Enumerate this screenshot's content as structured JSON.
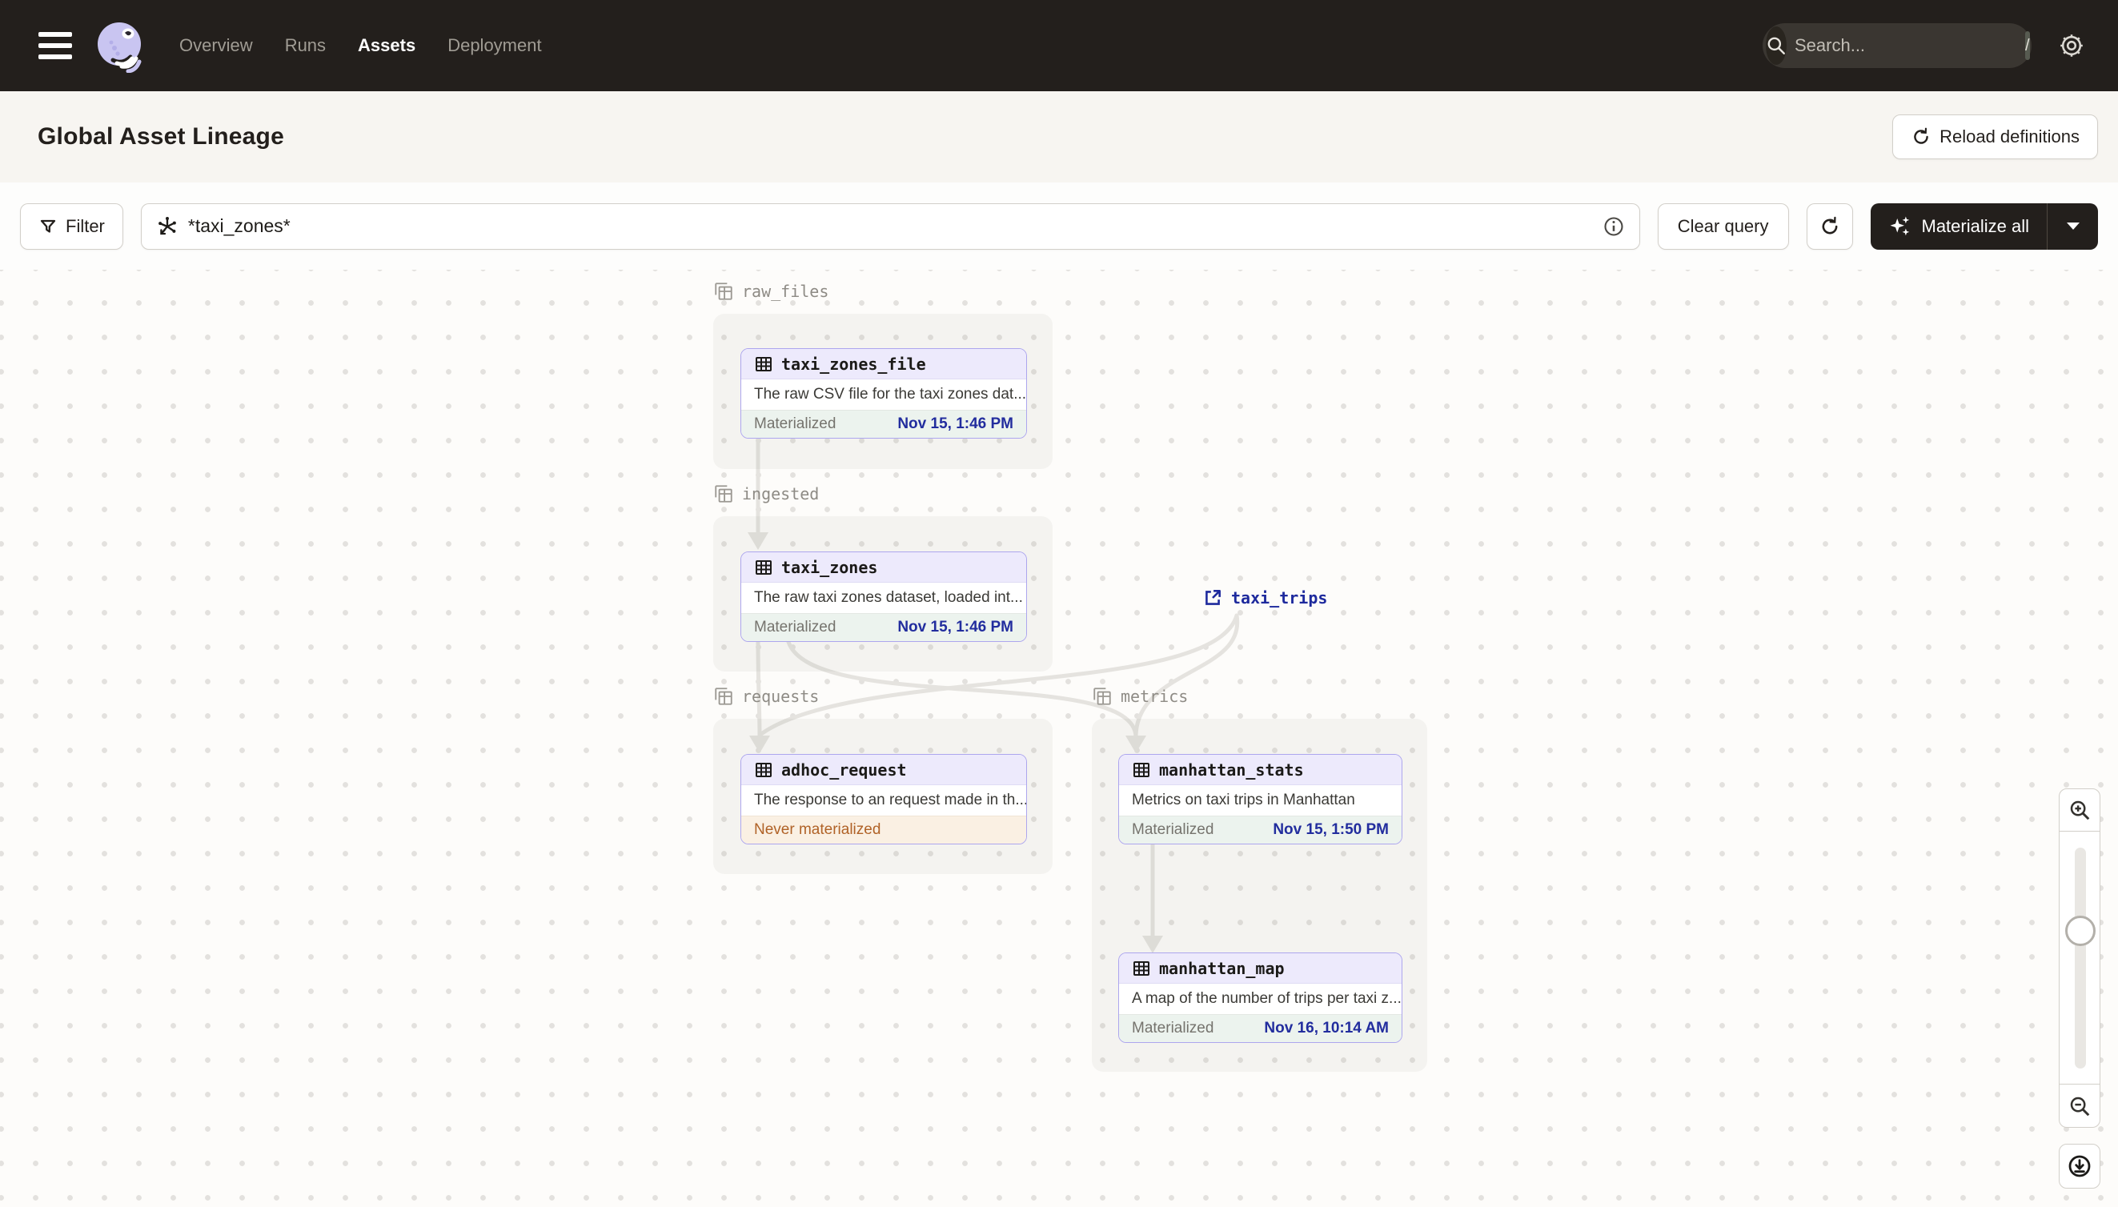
{
  "topnav": {
    "nav_items": [
      {
        "label": "Overview",
        "active": false
      },
      {
        "label": "Runs",
        "active": false
      },
      {
        "label": "Assets",
        "active": true
      },
      {
        "label": "Deployment",
        "active": false
      }
    ],
    "search": {
      "placeholder": "Search...",
      "shortcut": "/"
    }
  },
  "header": {
    "title": "Global Asset Lineage",
    "reload_button_label": "Reload definitions"
  },
  "toolbar": {
    "filter_button_label": "Filter",
    "query_value": "*taxi_zones*",
    "clear_button_label": "Clear query",
    "materialize_button_label": "Materialize all"
  },
  "graph": {
    "groups": [
      {
        "name": "raw_files"
      },
      {
        "name": "ingested"
      },
      {
        "name": "requests"
      },
      {
        "name": "metrics"
      }
    ],
    "external_asset": {
      "name": "taxi_trips"
    },
    "nodes": [
      {
        "name": "taxi_zones_file",
        "description": "The raw CSV file for the taxi zones dat...",
        "status_label": "Materialized",
        "timestamp": "Nov 15, 1:46 PM"
      },
      {
        "name": "taxi_zones",
        "description": "The raw taxi zones dataset, loaded int...",
        "status_label": "Materialized",
        "timestamp": "Nov 15, 1:46 PM"
      },
      {
        "name": "adhoc_request",
        "description": "The response to an request made in th...",
        "status_label": "Never materialized",
        "timestamp": ""
      },
      {
        "name": "manhattan_stats",
        "description": "Metrics on taxi trips in Manhattan",
        "status_label": "Materialized",
        "timestamp": "Nov 15, 1:50 PM"
      },
      {
        "name": "manhattan_map",
        "description": "A map of the number of trips per taxi z...",
        "status_label": "Materialized",
        "timestamp": "Nov 16, 10:14 AM"
      }
    ]
  },
  "colors": {
    "topnav_bg": "#231f1c",
    "accent_navy": "#222d9e",
    "node_border": "#ada6ee",
    "node_header_bg": "#edeafc",
    "materialized_bg": "#ecf3ee",
    "never_materialized_bg": "#faf0e3",
    "never_materialized_text": "#b06227",
    "edge_color": "#e5e3df"
  }
}
